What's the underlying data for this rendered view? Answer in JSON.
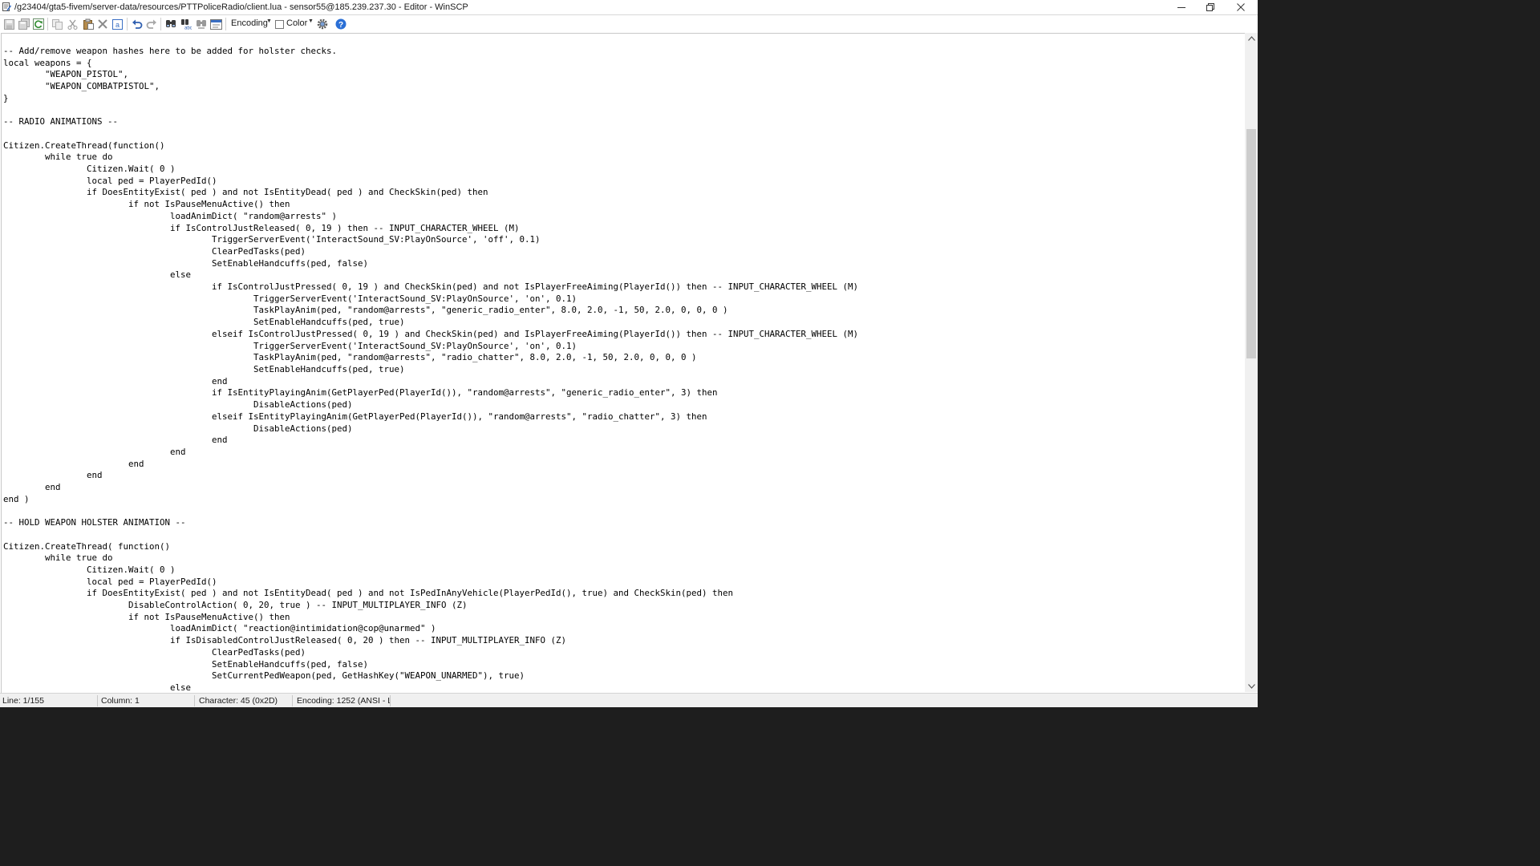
{
  "window": {
    "title": "/g23404/gta5-fivem/server-data/resources/PTTPoliceRadio/client.lua - sensor55@185.239.237.30 - Editor - WinSCP",
    "icons": {
      "app": "notepad-icon",
      "minimize": "minimize-icon",
      "maximize": "restore-icon",
      "close": "close-icon"
    }
  },
  "toolbar": {
    "encoding_label": "Encoding",
    "color_label": "Color",
    "icons": [
      "save-icon",
      "save-all-icon",
      "reload-icon",
      "copy-icon",
      "cut-icon",
      "paste-icon",
      "delete-icon",
      "select-all-icon",
      "undo-icon",
      "redo-icon",
      "find-icon",
      "replace-icon",
      "find-next-icon",
      "goto-line-icon",
      "settings-icon",
      "help-icon"
    ]
  },
  "editor": {
    "lines": [
      "-- Add/remove weapon hashes here to be added for holster checks.",
      "local weapons = {",
      "\t\"WEAPON_PISTOL\",",
      "\t\"WEAPON_COMBATPISTOL\",",
      "}",
      "",
      "-- RADIO ANIMATIONS --",
      "",
      "Citizen.CreateThread(function()",
      "\twhile true do",
      "\t\tCitizen.Wait( 0 )",
      "\t\tlocal ped = PlayerPedId()",
      "\t\tif DoesEntityExist( ped ) and not IsEntityDead( ped ) and CheckSkin(ped) then",
      "\t\t\tif not IsPauseMenuActive() then",
      "\t\t\t\tloadAnimDict( \"random@arrests\" )",
      "\t\t\t\tif IsControlJustReleased( 0, 19 ) then -- INPUT_CHARACTER_WHEEL (M)",
      "\t\t\t\t\tTriggerServerEvent('InteractSound_SV:PlayOnSource', 'off', 0.1)",
      "\t\t\t\t\tClearPedTasks(ped)",
      "\t\t\t\t\tSetEnableHandcuffs(ped, false)",
      "\t\t\t\telse",
      "\t\t\t\t\tif IsControlJustPressed( 0, 19 ) and CheckSkin(ped) and not IsPlayerFreeAiming(PlayerId()) then -- INPUT_CHARACTER_WHEEL (M)",
      "\t\t\t\t\t\tTriggerServerEvent('InteractSound_SV:PlayOnSource', 'on', 0.1)",
      "\t\t\t\t\t\tTaskPlayAnim(ped, \"random@arrests\", \"generic_radio_enter\", 8.0, 2.0, -1, 50, 2.0, 0, 0, 0 )",
      "\t\t\t\t\t\tSetEnableHandcuffs(ped, true)",
      "\t\t\t\t\telseif IsControlJustPressed( 0, 19 ) and CheckSkin(ped) and IsPlayerFreeAiming(PlayerId()) then -- INPUT_CHARACTER_WHEEL (M)",
      "\t\t\t\t\t\tTriggerServerEvent('InteractSound_SV:PlayOnSource', 'on', 0.1)",
      "\t\t\t\t\t\tTaskPlayAnim(ped, \"random@arrests\", \"radio_chatter\", 8.0, 2.0, -1, 50, 2.0, 0, 0, 0 )",
      "\t\t\t\t\t\tSetEnableHandcuffs(ped, true)",
      "\t\t\t\t\tend",
      "\t\t\t\t\tif IsEntityPlayingAnim(GetPlayerPed(PlayerId()), \"random@arrests\", \"generic_radio_enter\", 3) then",
      "\t\t\t\t\t\tDisableActions(ped)",
      "\t\t\t\t\telseif IsEntityPlayingAnim(GetPlayerPed(PlayerId()), \"random@arrests\", \"radio_chatter\", 3) then",
      "\t\t\t\t\t\tDisableActions(ped)",
      "\t\t\t\t\tend",
      "\t\t\t\tend",
      "\t\t\tend",
      "\t\tend",
      "\tend",
      "end )",
      "",
      "-- HOLD WEAPON HOLSTER ANIMATION --",
      "",
      "Citizen.CreateThread( function()",
      "\twhile true do",
      "\t\tCitizen.Wait( 0 )",
      "\t\tlocal ped = PlayerPedId()",
      "\t\tif DoesEntityExist( ped ) and not IsEntityDead( ped ) and not IsPedInAnyVehicle(PlayerPedId(), true) and CheckSkin(ped) then",
      "\t\t\tDisableControlAction( 0, 20, true ) -- INPUT_MULTIPLAYER_INFO (Z)",
      "\t\t\tif not IsPauseMenuActive() then",
      "\t\t\t\tloadAnimDict( \"reaction@intimidation@cop@unarmed\" )",
      "\t\t\t\tif IsDisabledControlJustReleased( 0, 20 ) then -- INPUT_MULTIPLAYER_INFO (Z)",
      "\t\t\t\t\tClearPedTasks(ped)",
      "\t\t\t\t\tSetEnableHandcuffs(ped, false)",
      "\t\t\t\t\tSetCurrentPedWeapon(ped, GetHashKey(\"WEAPON_UNARMED\"), true)",
      "\t\t\t\telse"
    ]
  },
  "statusbar": {
    "line": "Line: 1/155",
    "column": "Column: 1",
    "character": "Character: 45 (0x2D)",
    "encoding": "Encoding: 1252  (ANSI - La"
  }
}
